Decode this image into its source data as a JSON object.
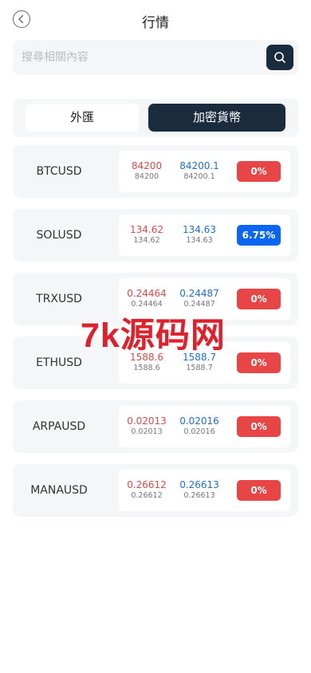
{
  "header": {
    "title": "行情",
    "back_icon": "chevron-left-circle-icon"
  },
  "search": {
    "placeholder": "搜尋相關內容",
    "value": "",
    "icon": "search-icon"
  },
  "tabs": [
    {
      "label": "外匯",
      "active": false
    },
    {
      "label": "加密貨幣",
      "active": true
    }
  ],
  "colors": {
    "dark": "#1b2b3e",
    "bid": "#e04848",
    "ask": "#1d6fd6",
    "negative": "#e84646",
    "positive": "#0a66f2"
  },
  "quotes": [
    {
      "symbol": "BTCUSD",
      "bid": "84200",
      "bid_sub": "84200",
      "ask": "84200.1",
      "ask_sub": "84200.1",
      "change": "0%",
      "direction": "down"
    },
    {
      "symbol": "SOLUSD",
      "bid": "134.62",
      "bid_sub": "134.62",
      "ask": "134.63",
      "ask_sub": "134.63",
      "change": "6.75%",
      "direction": "up"
    },
    {
      "symbol": "TRXUSD",
      "bid": "0.24464",
      "bid_sub": "0.24464",
      "ask": "0.24487",
      "ask_sub": "0.24487",
      "change": "0%",
      "direction": "down"
    },
    {
      "symbol": "ETHUSD",
      "bid": "1588.6",
      "bid_sub": "1588.6",
      "ask": "1588.7",
      "ask_sub": "1588.7",
      "change": "0%",
      "direction": "down"
    },
    {
      "symbol": "ARPAUSD",
      "bid": "0.02013",
      "bid_sub": "0.02013",
      "ask": "0.02016",
      "ask_sub": "0.02016",
      "change": "0%",
      "direction": "down"
    },
    {
      "symbol": "MANAUSD",
      "bid": "0.26612",
      "bid_sub": "0.26612",
      "ask": "0.26613",
      "ask_sub": "0.26613",
      "change": "0%",
      "direction": "down"
    }
  ],
  "watermark": "7k源码网"
}
